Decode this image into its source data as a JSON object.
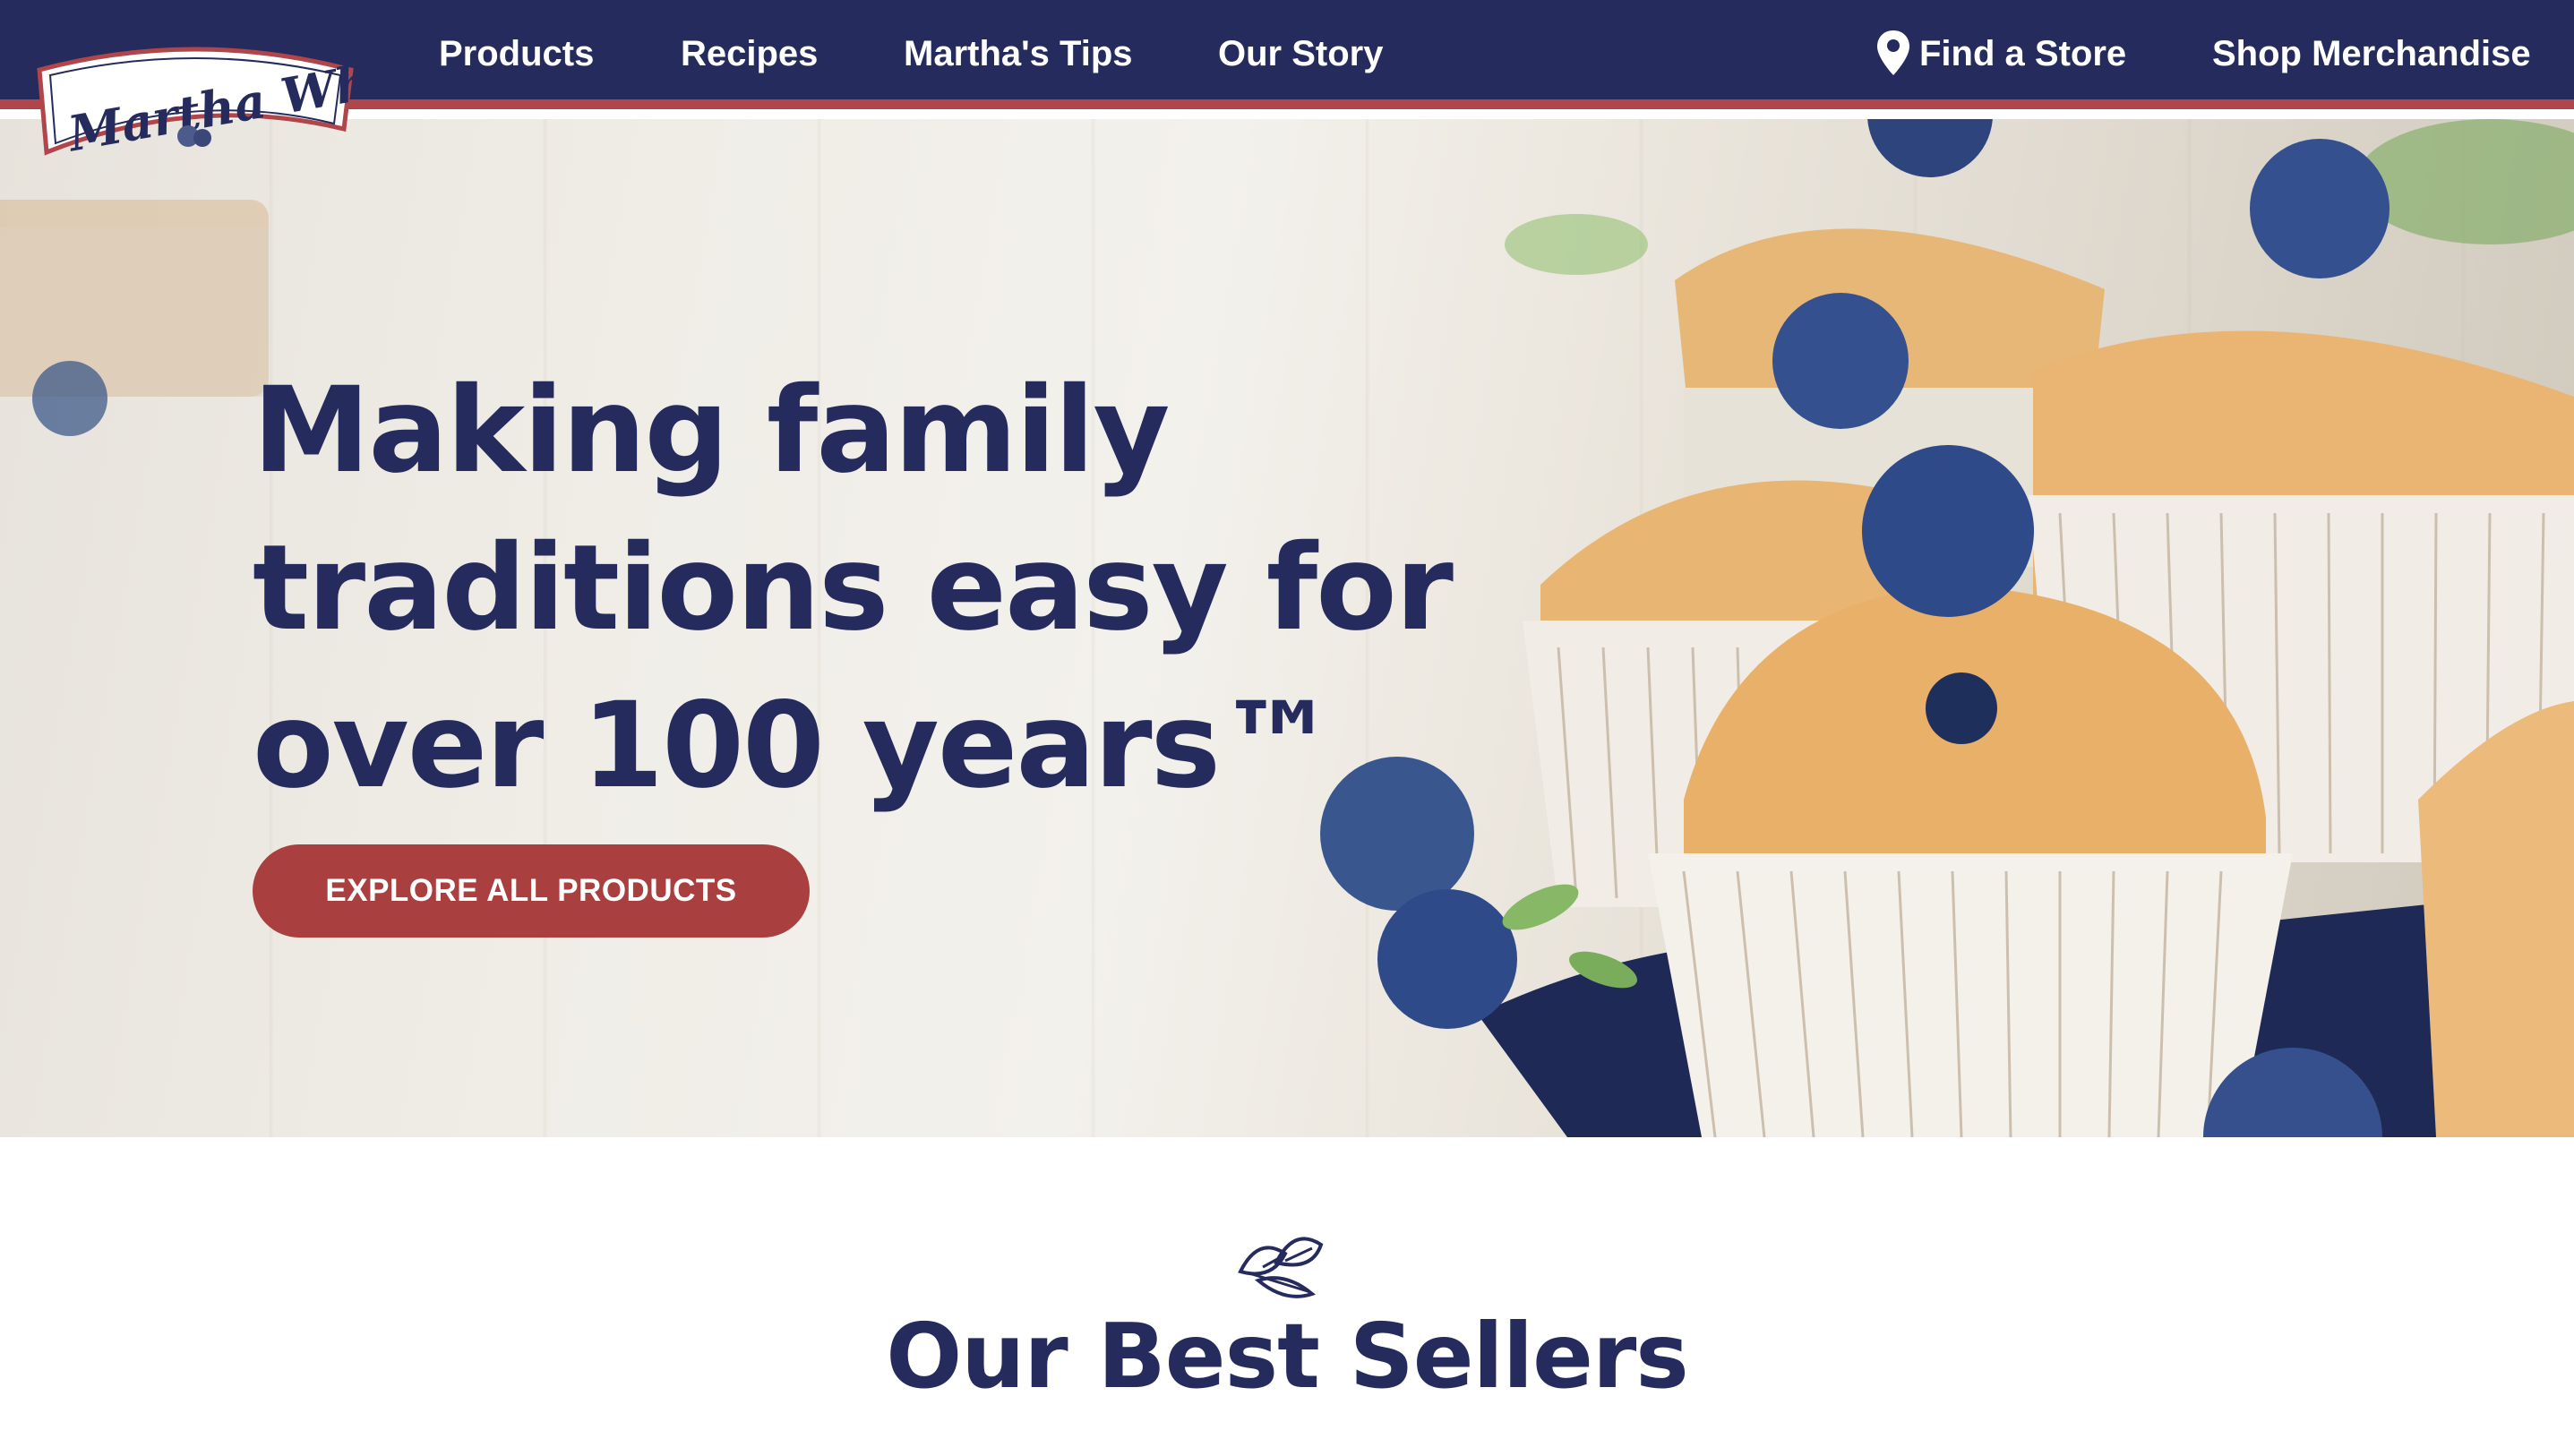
{
  "brand": {
    "logo_text": "Martha White"
  },
  "nav": {
    "products": "Products",
    "recipes": "Recipes",
    "tips": "Martha's Tips",
    "story": "Our Story",
    "find_store": "Find a Store",
    "shop": "Shop Merchandise"
  },
  "hero": {
    "title_line1": "Making family",
    "title_line2": "traditions easy for",
    "title_line3": "over 100 years™",
    "button": "EXPLORE ALL PRODUCTS"
  },
  "best_sellers": {
    "title": "Our Best Sellers"
  },
  "colors": {
    "navy": "#252b5c",
    "brand_red": "#b0454a",
    "button_red": "#a9403f",
    "white": "#ffffff"
  },
  "icons": {
    "location": "map-pin-icon",
    "section_ornament": "leaf-sprig-icon"
  }
}
